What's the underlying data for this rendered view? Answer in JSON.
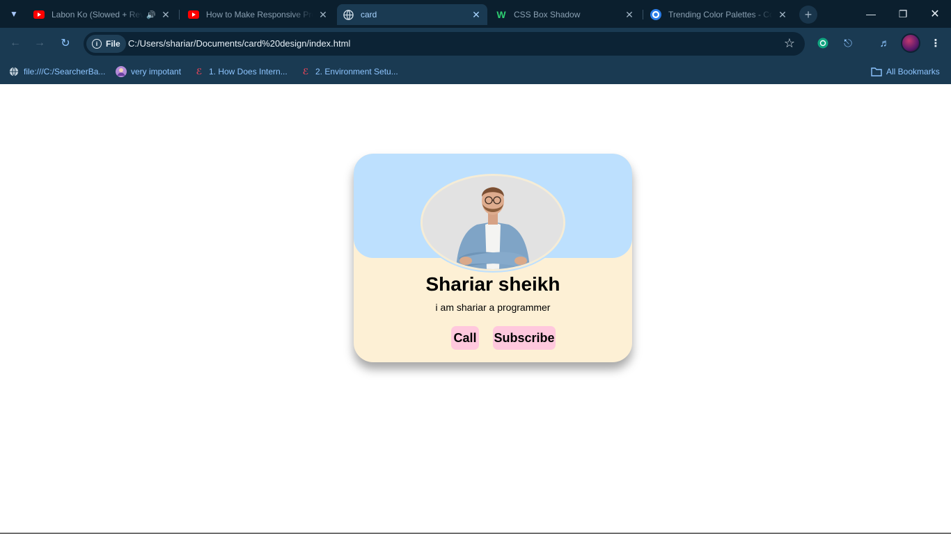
{
  "browser": {
    "tabs": [
      {
        "title": "Labon Ko (Slowed + Reverb)",
        "favicon": "youtube-icon",
        "audio": true,
        "active": false
      },
      {
        "title": "How to Make Responsive Profile Card",
        "favicon": "youtube-icon",
        "audio": false,
        "active": false
      },
      {
        "title": "card",
        "favicon": "globe-icon",
        "audio": false,
        "active": true
      },
      {
        "title": "CSS Box Shadow",
        "favicon": "w-icon",
        "audio": false,
        "active": false
      },
      {
        "title": "Trending Color Palettes - Coolors",
        "favicon": "coolors-icon",
        "audio": false,
        "active": false
      }
    ],
    "site_chip": "File",
    "url": "C:/Users/shariar/Documents/card%20design/index.html",
    "bookmarks": [
      {
        "label": "file:///C:/SearcherBa...",
        "icon": "globe-icon"
      },
      {
        "label": "very impotant",
        "icon": "avatar-icon"
      },
      {
        "label": "1. How Does Intern...",
        "icon": "bookmark-site-icon"
      },
      {
        "label": "2. Environment Setu...",
        "icon": "bookmark-site-icon"
      }
    ],
    "all_bookmarks": "All Bookmarks"
  },
  "card": {
    "name": "Shariar sheikh",
    "role": "i am shariar a programmer",
    "buttons": {
      "call": "Call",
      "subscribe": "Subscribe"
    },
    "colors": {
      "top": "#bde0fe",
      "body": "#fdf0d5",
      "button": "#ffc8dd"
    }
  }
}
